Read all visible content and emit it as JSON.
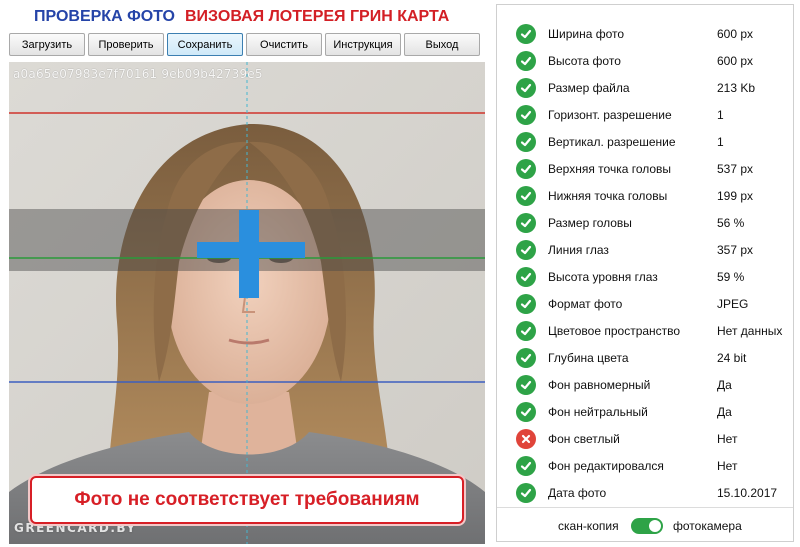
{
  "title": {
    "part1": "ПРОВЕРКА ФОТО",
    "part2": "ВИЗОВАЯ ЛОТЕРЕЯ ГРИН КАРТА"
  },
  "toolbar": {
    "buttons": [
      {
        "label": "Загрузить",
        "name": "load-button"
      },
      {
        "label": "Проверить",
        "name": "check-button"
      },
      {
        "label": "Сохранить",
        "name": "save-button",
        "active": true
      },
      {
        "label": "Очистить",
        "name": "clear-button"
      },
      {
        "label": "Инструкция",
        "name": "instruction-button"
      },
      {
        "label": "Выход",
        "name": "exit-button"
      }
    ]
  },
  "photo": {
    "hash": "a0a65e07983e7f70161 9eb09b42739e5",
    "watermark": "GREENCARD.BY",
    "verdict": "Фото не соответствует требованиям"
  },
  "checks": [
    {
      "label": "Ширина фото",
      "value": "600 px",
      "status": "ok"
    },
    {
      "label": "Высота фото",
      "value": "600 px",
      "status": "ok"
    },
    {
      "label": "Размер файла",
      "value": "213 Kb",
      "status": "ok"
    },
    {
      "label": "Горизонт. разрешение",
      "value": "1",
      "status": "ok"
    },
    {
      "label": "Вертикал. разрешение",
      "value": "1",
      "status": "ok"
    },
    {
      "label": "Верхняя точка головы",
      "value": "537 px",
      "status": "ok"
    },
    {
      "label": "Нижняя точка головы",
      "value": "199 px",
      "status": "ok"
    },
    {
      "label": "Размер головы",
      "value": "56 %",
      "status": "ok"
    },
    {
      "label": "Линия глаз",
      "value": "357 px",
      "status": "ok"
    },
    {
      "label": "Высота уровня глаз",
      "value": "59 %",
      "status": "ok"
    },
    {
      "label": "Формат фото",
      "value": "JPEG",
      "status": "ok"
    },
    {
      "label": "Цветовое пространство",
      "value": "Нет данных",
      "status": "ok"
    },
    {
      "label": "Глубина цвета",
      "value": "24 bit",
      "status": "ok"
    },
    {
      "label": "Фон равномерный",
      "value": "Да",
      "status": "ok"
    },
    {
      "label": "Фон нейтральный",
      "value": "Да",
      "status": "ok"
    },
    {
      "label": "Фон светлый",
      "value": "Нет",
      "status": "fail"
    },
    {
      "label": "Фон редактировался",
      "value": "Нет",
      "status": "ok"
    },
    {
      "label": "Дата фото",
      "value": "15.10.2017",
      "status": "ok"
    }
  ],
  "mode": {
    "left_label": "скан-копия",
    "right_label": "фотокамера",
    "toggle_on": true
  },
  "colors": {
    "ok": "#2ea347",
    "fail": "#e0443a",
    "title_blue": "#2544a8",
    "title_red": "#d31f25"
  }
}
